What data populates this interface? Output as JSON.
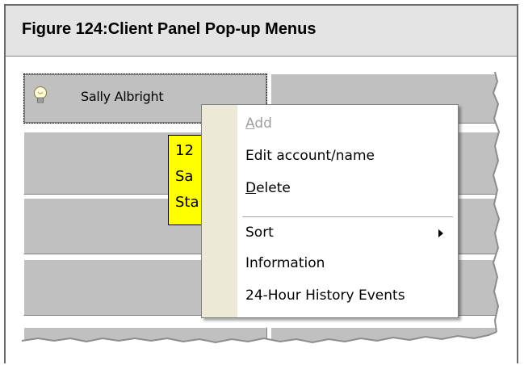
{
  "figure": {
    "title": "Figure 124:Client Panel Pop-up Menus"
  },
  "client_panel": {
    "client_name": "Sally Albright",
    "yellow_tile_lines": [
      "12",
      "Sa",
      "Sta"
    ]
  },
  "context_menu": {
    "items": [
      {
        "label": "Add",
        "accel": "A",
        "rest": "dd",
        "enabled": false
      },
      {
        "label": "Edit account/name",
        "enabled": true
      },
      {
        "label": "Delete",
        "accel": "D",
        "rest": "elete",
        "enabled": true
      },
      {
        "label": "Sort",
        "enabled": true,
        "submenu": true
      },
      {
        "label": "Information",
        "enabled": true
      },
      {
        "label": "24-Hour History Events",
        "enabled": true
      }
    ]
  },
  "colors": {
    "header_bg": "#e4e4e4",
    "cell_bg": "#c0c0c0",
    "tile_highlight": "#ffff00",
    "menu_gutter": "#ece9d8",
    "disabled_text": "#a0a0a0"
  },
  "icons": [
    "light-bulb-icon",
    "submenu-arrow-icon"
  ]
}
